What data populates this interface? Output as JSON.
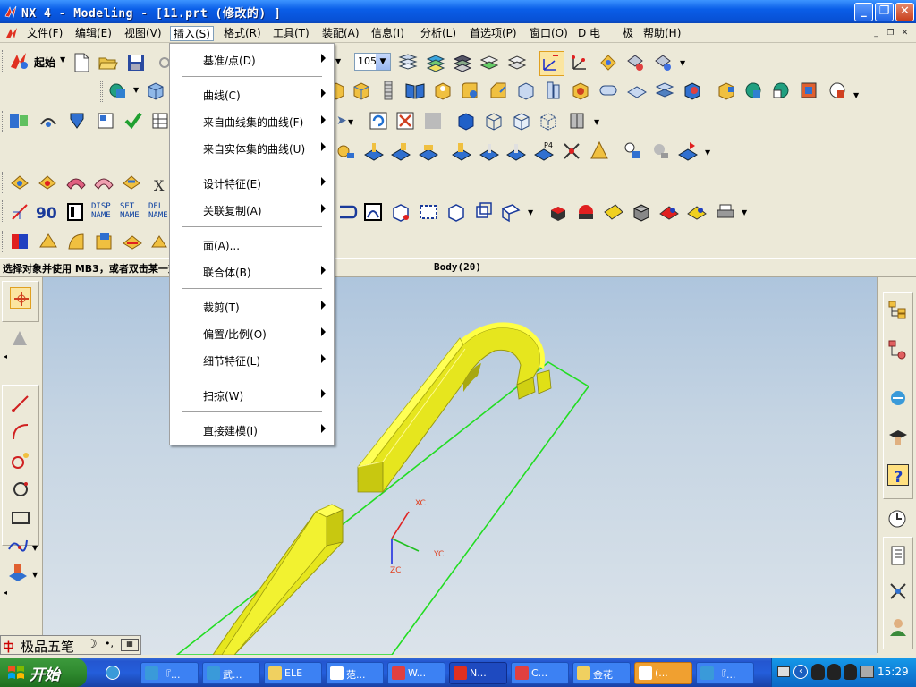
{
  "window": {
    "title": "NX 4 - Modeling - [11.prt  (修改的) ]"
  },
  "menubar": {
    "items": [
      "文件(F)",
      "编辑(E)",
      "视图(V)",
      "插入(S)",
      "格式(R)",
      "工具(T)",
      "装配(A)",
      "信息(I)",
      "分析(L)",
      "首选项(P)",
      "窗口(O)",
      "D 电",
      "极",
      "帮助(H)"
    ],
    "active_item": "插入(S)"
  },
  "toolbar": {
    "start_label": "起始",
    "zoom_value": "105",
    "text_buttons": [
      {
        "line1": "DISP",
        "line2": "NAME"
      },
      {
        "line1": "SET",
        "line2": "NAME"
      },
      {
        "line1": "DEL",
        "line2": "NAME"
      }
    ],
    "dim_label": "90",
    "xy_label": "X"
  },
  "statusbar": {
    "prompt": "选择对象并使用 MB3，或者双击某一对象",
    "status": "Body(20)"
  },
  "insert_menu": {
    "items": [
      {
        "label": "基准/点(D)",
        "submenu": true
      },
      {
        "label": "曲线(C)",
        "submenu": true
      },
      {
        "label": "来自曲线集的曲线(F)",
        "submenu": true
      },
      {
        "label": "来自实体集的曲线(U)",
        "submenu": true
      },
      {
        "label": "设计特征(E)",
        "submenu": true
      },
      {
        "label": "关联复制(A)",
        "submenu": true
      },
      {
        "label": "面(A)...",
        "submenu": false
      },
      {
        "label": "联合体(B)",
        "submenu": true
      },
      {
        "label": "裁剪(T)",
        "submenu": true
      },
      {
        "label": "偏置/比例(O)",
        "submenu": true
      },
      {
        "label": "细节特征(L)",
        "submenu": true
      },
      {
        "label": "扫掠(W)",
        "submenu": true
      },
      {
        "label": "直接建模(I)",
        "submenu": true
      }
    ]
  },
  "graphics": {
    "axis_labels": {
      "x": "XC",
      "y": "YC",
      "z": "ZC"
    },
    "colors": {
      "model": "#ffff22",
      "datum_plane": "#22dd22",
      "x_axis": "#e02020",
      "y_axis": "#20c020",
      "z_axis": "#2030e0"
    }
  },
  "ime": {
    "indicator": "中",
    "name": "极品五笔"
  },
  "taskbar": {
    "start_label": "开始",
    "tasks": [
      "『...",
      "武...",
      "ELE",
      "范...",
      "W...",
      "N...",
      "C...",
      "金花",
      "(...",
      "『..."
    ],
    "active_task": "N...",
    "clock": "15:29"
  }
}
